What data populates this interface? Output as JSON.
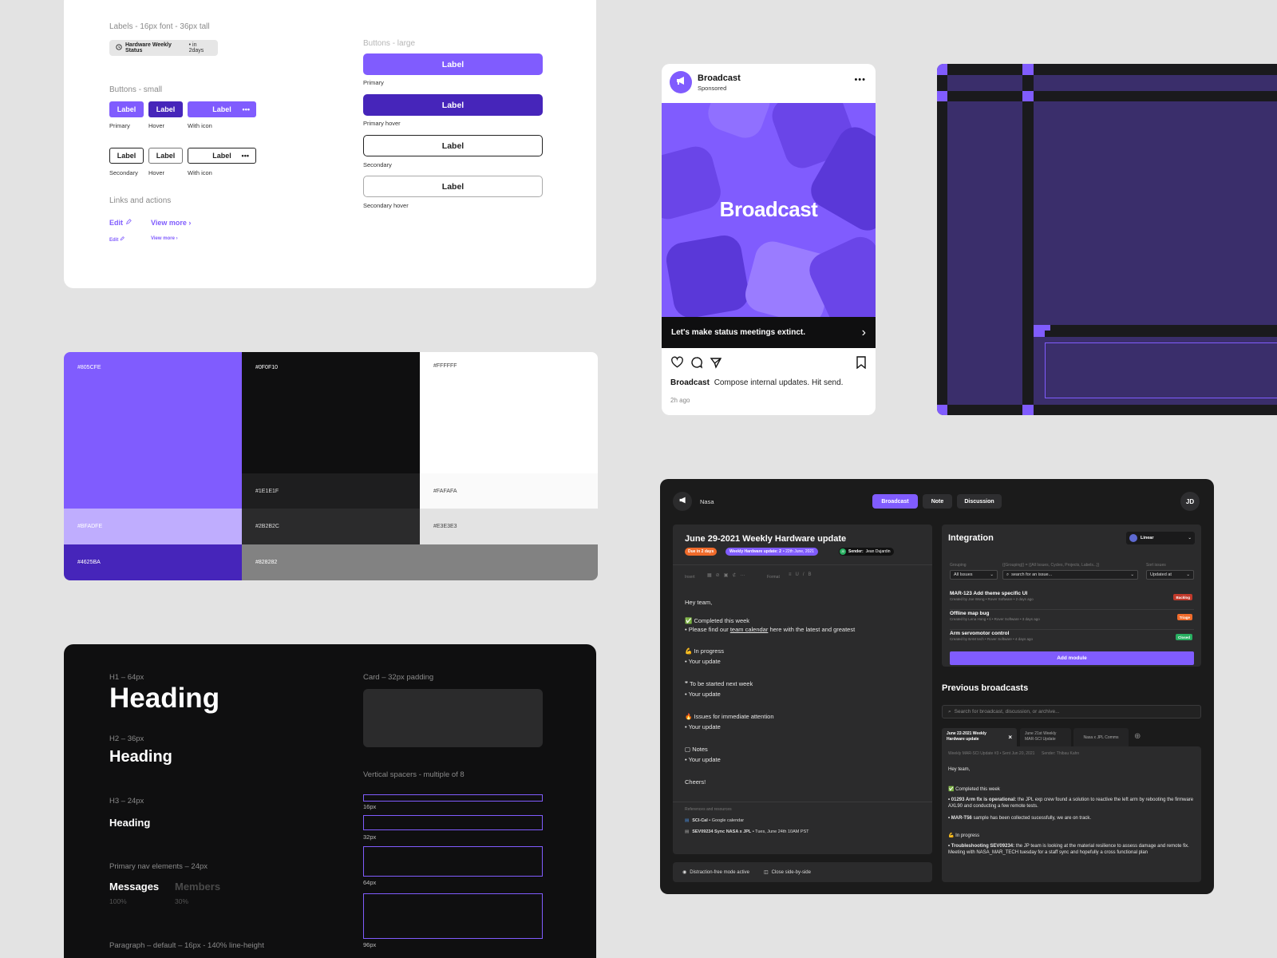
{
  "colors": {
    "primary": "#805CFE",
    "primary_hover": "#4625BA",
    "black": "#0F0F10",
    "white": "#FFFFFF",
    "page_bg": "#E3E3E3"
  },
  "components": {
    "labels_title": "Labels - 16px font - 36px tall",
    "chip_bold": "Hardware Weekly Status",
    "chip_rest": "• in 2days",
    "buttons_small_title": "Buttons - small",
    "small_primary_row": [
      {
        "label": "Label",
        "caption": "Primary"
      },
      {
        "label": "Label",
        "caption": "Hover"
      },
      {
        "label": "Label",
        "caption": "With icon"
      }
    ],
    "small_secondary_row": [
      {
        "label": "Label",
        "caption": "Secondary"
      },
      {
        "label": "Label",
        "caption": "Hover"
      },
      {
        "label": "Label",
        "caption": "With icon"
      }
    ],
    "more_glyph": "•••",
    "links_title": "Links and actions",
    "link_edit": "Edit",
    "link_view_more": "View more",
    "buttons_large_title": "Buttons - large",
    "large_buttons": [
      {
        "label": "Label",
        "caption": "Primary"
      },
      {
        "label": "Label",
        "caption": "Primary hover"
      },
      {
        "label": "Label",
        "caption": "Secondary"
      },
      {
        "label": "Label",
        "caption": "Secondary hover"
      }
    ]
  },
  "palette": [
    {
      "hex": "#805CFE",
      "label": "#805CFE"
    },
    {
      "hex": "#0F0F10",
      "label": "#0F0F10"
    },
    {
      "hex": "#FFFFFF",
      "label": "#FFFFFF"
    },
    {
      "hex": "#1E1E1F",
      "label": "#1E1E1F"
    },
    {
      "hex": "#FAFAFA",
      "label": "#FAFAFA"
    },
    {
      "hex": "#BFADFE",
      "label": "#BFADFE"
    },
    {
      "hex": "#2B2B2C",
      "label": "#2B2B2C"
    },
    {
      "hex": "#E3E3E3",
      "label": "#E3E3E3"
    },
    {
      "hex": "#4625BA",
      "label": "#4625BA"
    },
    {
      "hex": "#828282",
      "label": "#828282"
    }
  ],
  "typography": {
    "h1_label": "H1 – 64px",
    "h1": "Heading",
    "h2_label": "H2 – 36px",
    "h2": "Heading",
    "h3_label": "H3 – 24px",
    "h3": "Heading",
    "nav_label": "Primary nav elements – 24px",
    "nav_items": [
      {
        "label": "Messages",
        "pct": "100%"
      },
      {
        "label": "Members",
        "pct": "30%"
      }
    ],
    "paragraph_label": "Paragraph –  default – 16px - 140% line-height",
    "card_label": "Card – 32px padding",
    "spacers_label": "Vertical spacers - multiple of 8",
    "spacers": [
      "16px",
      "32px",
      "64px",
      "96px"
    ]
  },
  "post": {
    "brand": "Broadcast",
    "sponsored": "Sponsored",
    "more": "•••",
    "hero_text": "Broadcast",
    "cta": "Let's make status meetings extinct.",
    "caption_brand": "Broadcast",
    "caption_text": "Compose internal updates. Hit send.",
    "time": "2h ago"
  },
  "app": {
    "workspace": "Nasa",
    "tabs": [
      "Broadcast",
      "Note",
      "Discussion"
    ],
    "avatar": "JD",
    "doc_title": "June 29-2021 Weekly Hardware update",
    "due_badge": "Due in 2 days",
    "update_badge": "Weekly Hardware update: 2",
    "update_date": "• 22th June, 2021",
    "sender_avatar": "JD",
    "sender_label": "Sender:",
    "sender_name": "Jean Dujardin",
    "toolbar_insert": "Insert",
    "toolbar_format": "Format",
    "body": {
      "greeting": "Hey team,",
      "completed": "Completed this week",
      "find_pre": "• Please find our ",
      "find_link": "team calendar",
      "find_post": " here with the latest and greatest",
      "in_progress": "In progress",
      "your_update": "• Your update",
      "next_week": "To be started next week",
      "issues": "Issues for immediate attention",
      "notes": "Notes",
      "cheers": "Cheers!"
    },
    "refs_label": "References and resources",
    "refs": [
      {
        "bold": "SCI-Cal",
        "rest": " • Google calendar"
      },
      {
        "bold": "SEV09234 Sync NASA x JPL",
        "rest": " • Tues, June 24th 10AM PST"
      }
    ],
    "footer_left": "Distraction-free mode active",
    "footer_right": "Close side-by-side",
    "integration": {
      "title": "Integration",
      "provider": "Linear",
      "grouping_label": "Grouping",
      "grouping_value": "All Issues",
      "filter_label": "{{Grouping}} = {{All Issues, Cycles, Projects, Labels...}}",
      "search_placeholder": "search for an issue...",
      "sort_label": "Sort issues",
      "sort_value": "Updated at",
      "issues": [
        {
          "title": "MAR-123 Add theme specific UI",
          "meta": "Created by Joe Wong • Rover Software • 2 days ago",
          "tag": "Backlog",
          "tag_color": "#c0392b"
        },
        {
          "title": "Offline map bug",
          "meta": "Created by Lena Hong • ti • Rover Software • 3 days ago",
          "tag": "Triage",
          "tag_color": "#f06b2b"
        },
        {
          "title": "Arm servomotor control",
          "meta": "Created by BAM tech • Rover Software • 4 days ago",
          "tag": "Closed",
          "tag_color": "#27ae60"
        }
      ],
      "add_module": "Add module"
    },
    "previous": {
      "title": "Previous broadcasts",
      "search_placeholder": "Search for broadcast, discussion, or archive...",
      "tabs": [
        "June 22-2021 Weekly Hardware update",
        "June 21st Weekly MAR-SCI Update",
        "Nasa x JPL Comms"
      ],
      "meta_left": "Weekly MAR-SCI Update #3 • Sent Jun 20, 2021",
      "meta_right": "Sender: Thibau Kahn",
      "greeting": "Hey team,",
      "completed": "Completed this week",
      "item1_bold": "• 01293 Arm fix is operational:",
      "item1_rest": " the JPL exp crew found a solution to reactive the left arm by rebooting the firmware AXL90 and conducting a few remote tests.",
      "item2_bold": "• MAR-T56",
      "item2_rest": " sample has been collected sucessfully, we are on track.",
      "in_progress": "In progress",
      "item3_bold": "• Troubleshooting SEV09234:",
      "item3_rest": " the JP team is looking at the material resilience to assess damage and remote fix. Meeting with NASA_MAR_TECH tuesday for a staff sync and hopefully a cross functional plan"
    }
  }
}
